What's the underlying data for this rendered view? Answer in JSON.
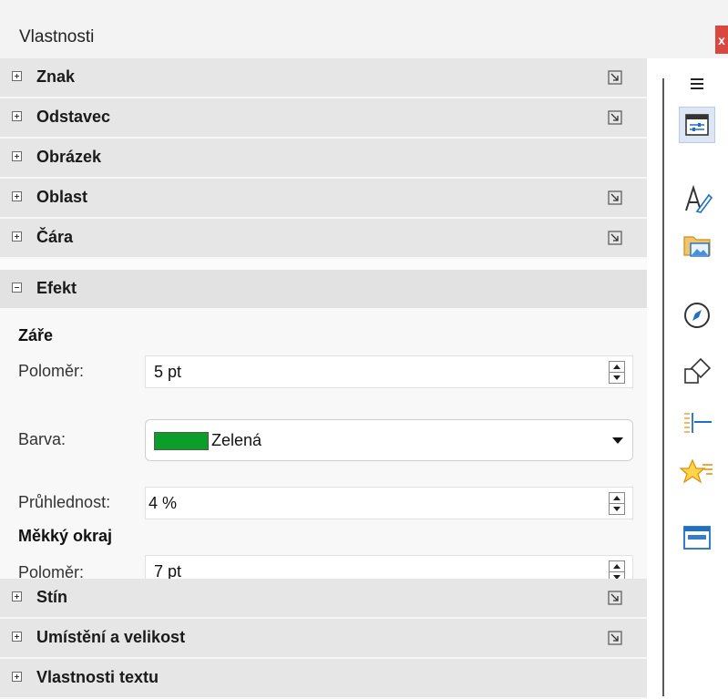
{
  "window": {
    "title": "Vlastnosti",
    "close_label": "x"
  },
  "sections": {
    "znak": {
      "label": "Znak"
    },
    "odstavec": {
      "label": "Odstavec"
    },
    "obrazek": {
      "label": "Obrázek"
    },
    "oblast": {
      "label": "Oblast"
    },
    "cara": {
      "label": "Čára"
    },
    "efekt": {
      "label": "Efekt"
    },
    "stin": {
      "label": "Stín"
    },
    "umisteni": {
      "label": "Umístění a velikost"
    },
    "vlastnosti_textu": {
      "label": "Vlastnosti textu"
    }
  },
  "effect": {
    "glow": {
      "heading": "Záře",
      "radius_label": "Poloměr:",
      "radius_value": "5 pt",
      "color_label": "Barva:",
      "color_value": "Zelená",
      "color_hex": "#0c9e2b",
      "transparency_label": "Průhlednost:",
      "transparency_value": "4 %"
    },
    "soft_edge": {
      "heading": "Měkký okraj",
      "radius_label": "Poloměr:",
      "radius_value": "7 pt"
    }
  },
  "deck": {
    "items": [
      {
        "icon": "menu-icon"
      },
      {
        "icon": "properties-icon",
        "active": true
      },
      {
        "icon": "styles-icon"
      },
      {
        "icon": "gallery-icon"
      },
      {
        "icon": "navigator-icon"
      },
      {
        "icon": "shapes-icon"
      },
      {
        "icon": "slide-transition-icon"
      },
      {
        "icon": "animation-icon"
      },
      {
        "icon": "master-slides-icon"
      }
    ]
  },
  "colors": {
    "accent": "#0c9e2b",
    "header_bg": "#e6e6e6",
    "close_bg": "#d9473f"
  }
}
